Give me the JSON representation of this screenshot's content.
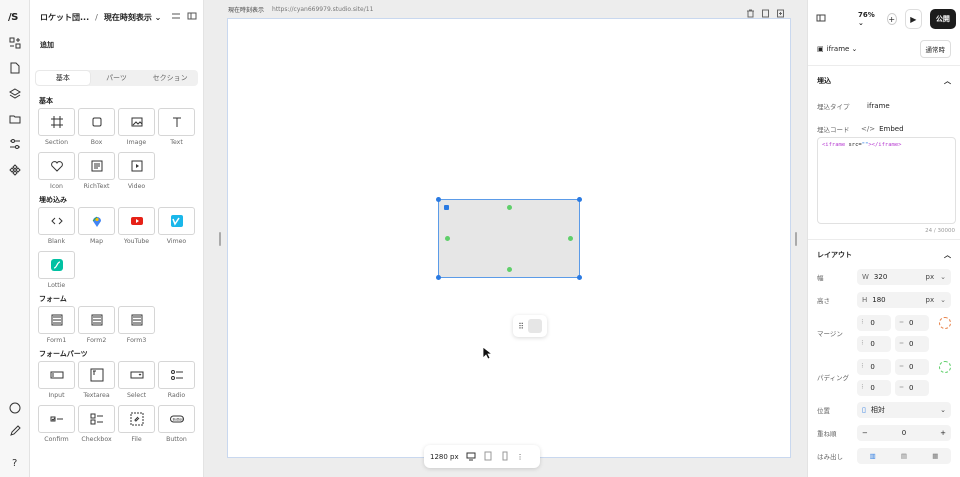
{
  "rail": {
    "logo": "/S"
  },
  "panel": {
    "project_name": "ロケット団...",
    "separator": "/",
    "page_name": "現在時刻表示 ⌄",
    "add_heading": "追加",
    "tabs": [
      "基本",
      "パーツ",
      "セクション"
    ],
    "sections": [
      {
        "title": "基本",
        "items": [
          {
            "label": "Section",
            "icon": "frame-icon"
          },
          {
            "label": "Box",
            "icon": "box-icon"
          },
          {
            "label": "Image",
            "icon": "image-icon"
          },
          {
            "label": "Text",
            "icon": "text-icon"
          },
          {
            "label": "Icon",
            "icon": "heart-icon"
          },
          {
            "label": "RichText",
            "icon": "richtext-icon"
          },
          {
            "label": "Video",
            "icon": "video-icon"
          }
        ]
      },
      {
        "title": "埋め込み",
        "items": [
          {
            "label": "Blank",
            "icon": "code-icon"
          },
          {
            "label": "Map",
            "icon": "map-pin-icon"
          },
          {
            "label": "YouTube",
            "icon": "youtube-icon"
          },
          {
            "label": "Vimeo",
            "icon": "vimeo-icon"
          },
          {
            "label": "Lottie",
            "icon": "lottie-icon"
          }
        ]
      },
      {
        "title": "フォーム",
        "items": [
          {
            "label": "Form1",
            "icon": "form-icon"
          },
          {
            "label": "Form2",
            "icon": "form-icon"
          },
          {
            "label": "Form3",
            "icon": "form-icon"
          }
        ]
      },
      {
        "title": "フォームパーツ",
        "items": [
          {
            "label": "Input",
            "icon": "input-icon"
          },
          {
            "label": "Textarea",
            "icon": "textarea-icon"
          },
          {
            "label": "Select",
            "icon": "select-icon"
          },
          {
            "label": "Radio",
            "icon": "radio-icon"
          },
          {
            "label": "Confirm",
            "icon": "checkbox-icon"
          },
          {
            "label": "Checkbox",
            "icon": "checkbox-list-icon"
          },
          {
            "label": "File",
            "icon": "file-icon"
          },
          {
            "label": "Button",
            "icon": "button-icon"
          }
        ]
      }
    ]
  },
  "canvas": {
    "page_title": "現在時刻表示",
    "url": "https://cyan669979.studio.site/11",
    "width_label": "1280 px"
  },
  "right": {
    "zoom": "76% ⌄",
    "publish": "公開",
    "element_name": "iframe ⌄",
    "state": "通常時",
    "embed_section": "埋込",
    "embed_type_label": "埋込タイプ",
    "embed_type_value": "iframe",
    "embed_code_label": "埋込コード",
    "embed_code_value": "Embed",
    "code_open": "<iframe",
    "code_attr": " src=",
    "code_str": "\"\"",
    "code_close": "></iframe>",
    "char_count": "24 / 30000",
    "layout_section": "レイアウト",
    "width_label": "幅",
    "width_prefix": "W",
    "width_value": "320",
    "width_unit": "px",
    "height_label": "高さ",
    "height_prefix": "H",
    "height_value": "180",
    "height_unit": "px",
    "margin_label": "マージン",
    "margin_values": [
      "0",
      "0",
      "0",
      "0"
    ],
    "padding_label": "パディング",
    "padding_values": [
      "0",
      "0",
      "0",
      "0"
    ],
    "position_label": "位置",
    "position_value": "相対",
    "stack_label": "重ね順",
    "stack_value": "0",
    "overflow_label": "はみ出し"
  },
  "colors": {
    "accent": "#2a7ae2",
    "handle_green": "#5fcf6a",
    "publish_bg": "#1c1c1c"
  }
}
